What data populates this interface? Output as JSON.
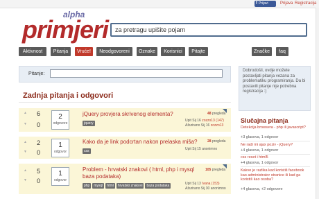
{
  "topbar": {
    "fb_label": "Prijavi",
    "login": "Prijava",
    "register": "Registracija"
  },
  "logo": {
    "text": "primjeri",
    "badge": "alpha"
  },
  "search": {
    "value": "za pretragu upišite pojam"
  },
  "nav": {
    "items": [
      "Aktivnost",
      "Pitanja",
      "Vruće!",
      "Neodgovoreni",
      "Oznake",
      "Korisnici",
      "Pitajte"
    ],
    "right": [
      "Značke",
      "faq"
    ]
  },
  "ask": {
    "label": "Pitanje:"
  },
  "heading": "Zadnja pitanja i odgovori",
  "questions": [
    {
      "votes": "6",
      "down": "0",
      "answers": "2",
      "answers_label": "odgovore",
      "title": "jQuery provjera skrivenog elementa?",
      "views": "48",
      "views_label": "pregleda",
      "tags": [
        "jquery"
      ],
      "meta1": "Upit Sij 16",
      "user1": "zozzo13 (147)",
      "meta2": "Ažurirano Sij 16",
      "user2": "zozzo13"
    },
    {
      "votes": "2",
      "down": "0",
      "answers": "1",
      "answers_label": "odgovor",
      "title": "Kako da je link podcrtan nakon prelaska miša?",
      "views": "28",
      "views_label": "pregleda",
      "tags": [
        "css"
      ],
      "meta1": "Upit Sij 15",
      "user1": "anonimno",
      "meta2": "",
      "user2": ""
    },
    {
      "votes": "5",
      "down": "0",
      "answers": "1",
      "answers_label": "odgovor",
      "title": "Problem - hrvatski znakovi ( html, php i mysql baza podataka)",
      "views": "105",
      "views_label": "pregleda",
      "tags": [
        "php",
        "mysql",
        "html",
        "hrvatski znakovi",
        "baza podataka"
      ],
      "meta1": "Upit Sij 13",
      "user1": "Ivana (153)",
      "meta2": "Ažurirano Sij 30",
      "user2": "anonimno"
    }
  ],
  "sidebar": {
    "info": "Dobrodošli, ovdje možete postavljati pitanja vezana za problematiku programiranja. Da bi postavili pitanje nije potrebna registracija :)",
    "title": "Slučajna pitanja",
    "items": [
      {
        "q": "Detekcija browsera - php ili javascript?",
        "meta": "+3 glasova, 1 odgovor"
      },
      {
        "q": "Ne radi mi ajax poziv - jQuery?",
        "meta": "+4 glasova, 1 odgovor"
      },
      {
        "q": "css reset i html5",
        "meta": "+4 glasova, 1 odgovor"
      },
      {
        "q": "Kakve je razlika kad koristiš facebook kao administrator stranice ili kad ga koristiš kao osoba?",
        "meta": "+4 glasova, +2 odgovore"
      }
    ]
  }
}
